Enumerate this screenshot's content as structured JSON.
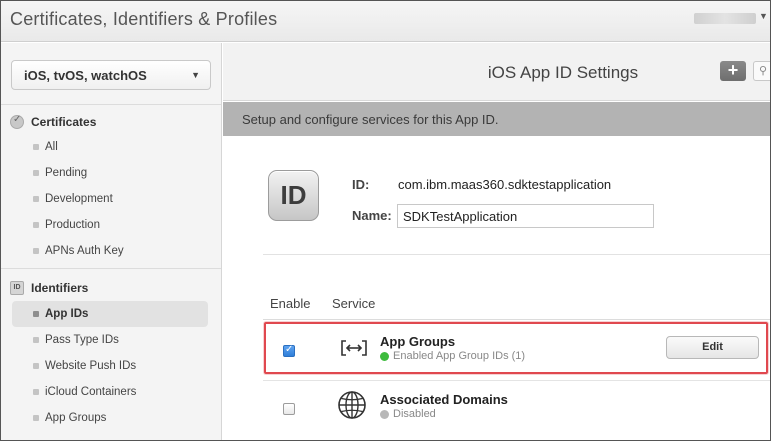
{
  "header": {
    "title": "Certificates, Identifiers & Profiles"
  },
  "sidebar": {
    "platform": "iOS, tvOS, watchOS",
    "sections": [
      {
        "title": "Certificates",
        "icon": "certificate-icon",
        "items": [
          "All",
          "Pending",
          "Development",
          "Production",
          "APNs Auth Key"
        ]
      },
      {
        "title": "Identifiers",
        "icon": "id-icon",
        "items": [
          "App IDs",
          "Pass Type IDs",
          "Website Push IDs",
          "iCloud Containers",
          "App Groups"
        ]
      }
    ],
    "active_item": "App IDs"
  },
  "main": {
    "title": "iOS App ID Settings",
    "add_label": "+",
    "banner": "Setup and configure services for this App ID.",
    "badge": "ID",
    "id_label": "ID:",
    "id_value": "com.ibm.maas360.sdktestapplication",
    "name_label": "Name:",
    "name_value": "SDKTestApplication",
    "table": {
      "columns": [
        "Enable",
        "Service"
      ],
      "rows": [
        {
          "name": "App Groups",
          "status": "Enabled App Group IDs (1)",
          "enabled": true,
          "status_color": "#3dbb3d",
          "icon": "app-groups-icon",
          "action": "Edit"
        },
        {
          "name": "Associated Domains",
          "status": "Disabled",
          "enabled": false,
          "status_color": "#b8b8b8",
          "icon": "globe-icon"
        }
      ]
    }
  },
  "colors": {
    "highlight": "#e0484f",
    "banner": "#b3b3b3",
    "checkbox_checked": "#2f7fd9"
  }
}
